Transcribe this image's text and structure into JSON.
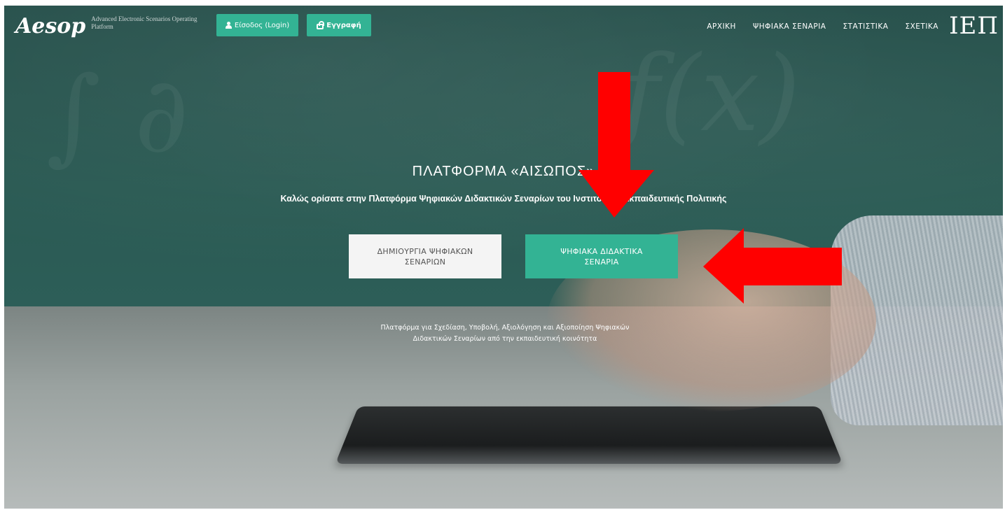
{
  "navbar": {
    "logo_text": "Aesop",
    "logo_tagline": "Advanced Electronic Scenarios Operating Platform",
    "login_label": "Είσοδος (Login)",
    "register_label": "Εγγραφή",
    "links": [
      "ΑΡΧΙΚΗ",
      "ΨΗΦΙΑΚΑ ΣΕΝΑΡΙΑ",
      "ΣΤΑΤΙΣΤΙΚΑ",
      "ΣΧΕΤΙΚΑ"
    ],
    "partner_logo": "ΙΕΠ"
  },
  "hero": {
    "title": "ΠΛΑΤΦΟΡΜΑ «ΑΙΣΩΠΟΣ»",
    "subtitle": "Καλώς ορίσατε στην Πλατφόρμα Ψηφιακών Διδακτικών Σεναρίων του Ινστιτούτου Εκπαιδευτικής Πολιτικής",
    "create_button": "ΔΗΜΙΟΥΡΓΙΑ ΨΗΦΙΑΚΩΝ ΣΕΝΑΡΙΩΝ",
    "scenarios_button": "ΨΗΦΙΑΚΑ ΔΙΔΑΚΤΙΚΑ ΣΕΝΑΡΙΑ",
    "description_line1": "Πλατφόρμα για Σχεδίαση, Υποβολή, Αξιολόγηση και Αξιοποίηση Ψηφιακών",
    "description_line2": "Διδακτικών Σεναρίων από την εκπαιδευτική κοινότητα"
  },
  "colors": {
    "accent": "#33b394",
    "annotation_arrow": "#ff0000"
  }
}
